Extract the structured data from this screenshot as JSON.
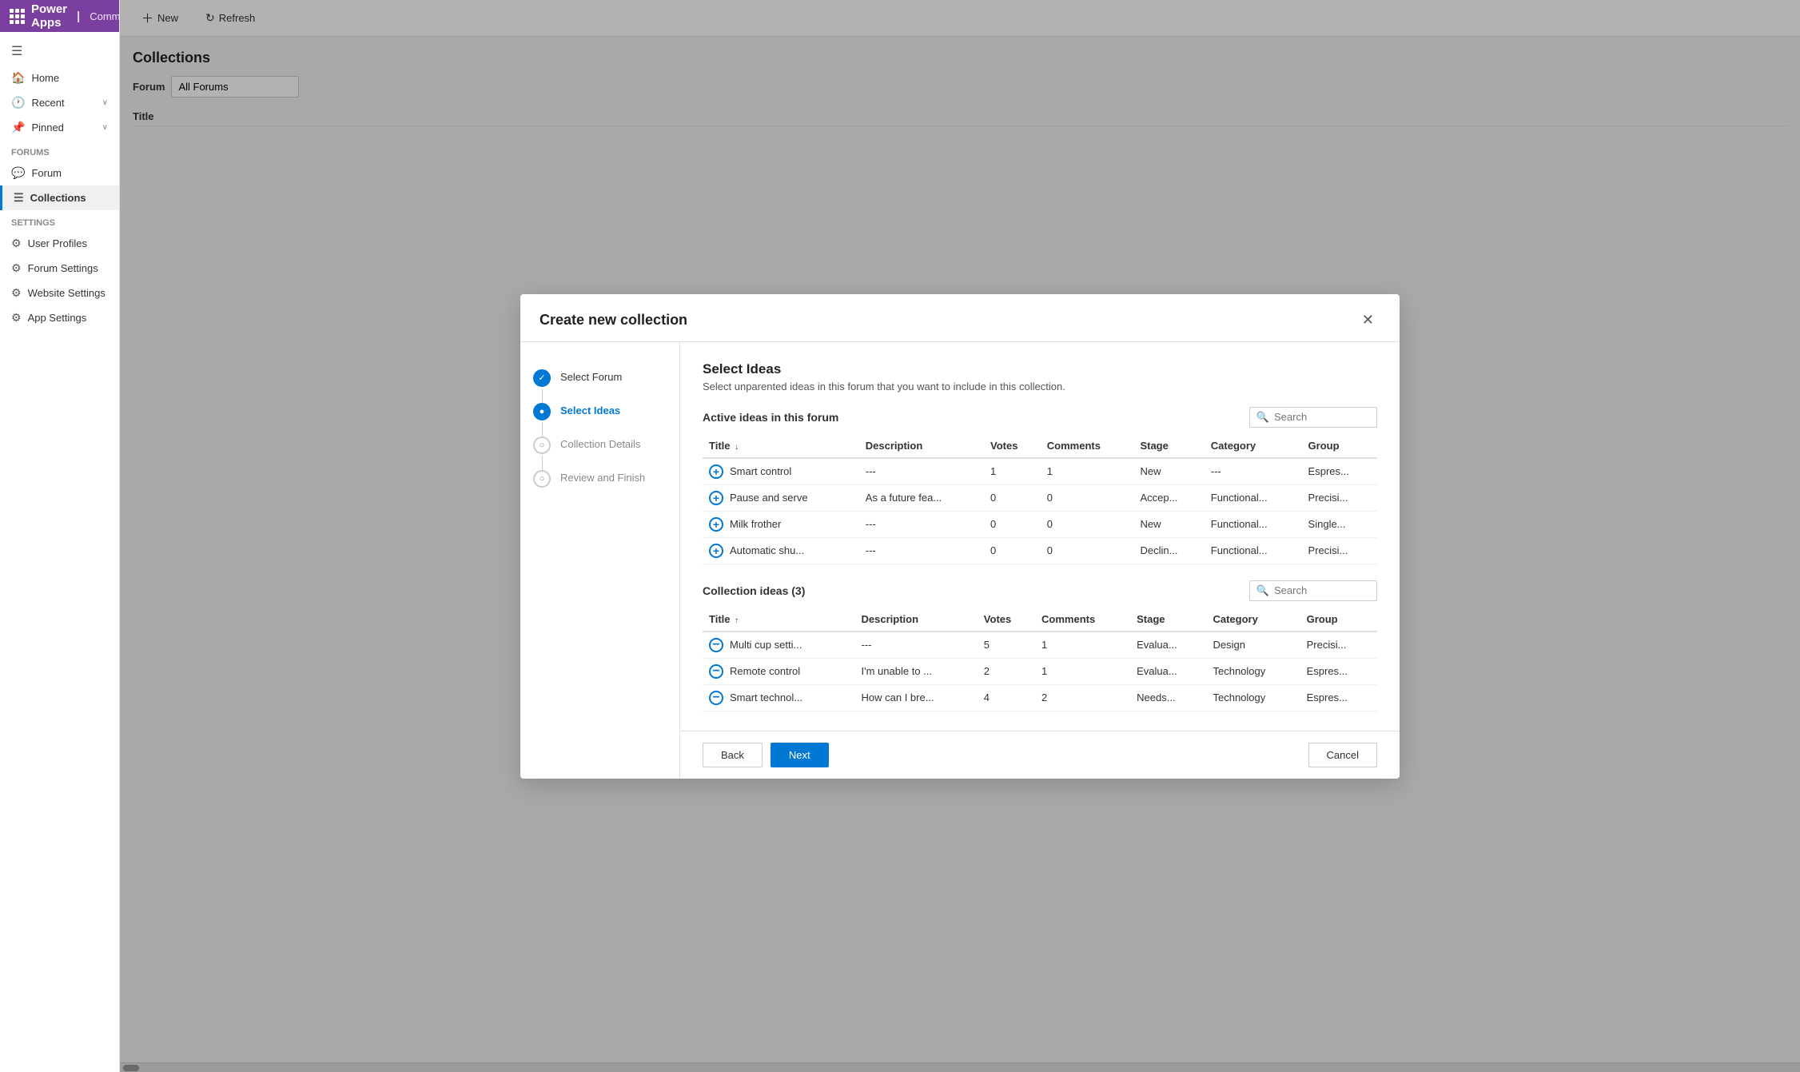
{
  "app": {
    "name": "Power Apps",
    "community": "Community"
  },
  "sidebar": {
    "sections": [
      {
        "items": [
          {
            "id": "home",
            "label": "Home",
            "icon": "🏠"
          },
          {
            "id": "recent",
            "label": "Recent",
            "icon": "🕐",
            "hasChevron": true
          },
          {
            "id": "pinned",
            "label": "Pinned",
            "icon": "📌",
            "hasChevron": true
          }
        ]
      },
      {
        "label": "Forums",
        "items": [
          {
            "id": "forum",
            "label": "Forum",
            "icon": "💬"
          },
          {
            "id": "collections",
            "label": "Collections",
            "icon": "📋",
            "active": true
          }
        ]
      },
      {
        "label": "Settings",
        "items": [
          {
            "id": "user-profiles",
            "label": "User Profiles",
            "icon": "👤"
          },
          {
            "id": "forum-settings",
            "label": "Forum Settings",
            "icon": "⚙"
          },
          {
            "id": "website-settings",
            "label": "Website Settings",
            "icon": "⚙"
          },
          {
            "id": "app-settings",
            "label": "App Settings",
            "icon": "⚙"
          }
        ]
      }
    ]
  },
  "toolbar": {
    "new_label": "New",
    "refresh_label": "Refresh"
  },
  "page": {
    "title": "Collections",
    "filter_placeholder": "All Forums",
    "table": {
      "columns": [
        "Title"
      ]
    }
  },
  "modal": {
    "title": "Create new collection",
    "steps": [
      {
        "id": "select-forum",
        "label": "Select Forum",
        "state": "completed"
      },
      {
        "id": "select-ideas",
        "label": "Select Ideas",
        "state": "active"
      },
      {
        "id": "collection-details",
        "label": "Collection Details",
        "state": "inactive"
      },
      {
        "id": "review-finish",
        "label": "Review and Finish",
        "state": "inactive"
      }
    ],
    "content": {
      "title": "Select Ideas",
      "subtitle": "Select unparented ideas in this forum that you want to include in this collection.",
      "active_section": {
        "label": "Active ideas in this forum",
        "search_placeholder": "Search",
        "columns": [
          "Title",
          "Description",
          "Votes",
          "Comments",
          "Stage",
          "Category",
          "Group"
        ],
        "title_sort": "↓",
        "rows": [
          {
            "title": "Smart control",
            "description": "---",
            "votes": "1",
            "comments": "1",
            "stage": "New",
            "category": "---",
            "group": "Espres..."
          },
          {
            "title": "Pause and serve",
            "description": "As a future fea...",
            "votes": "0",
            "comments": "0",
            "stage": "Accep...",
            "category": "Functional...",
            "group": "Precisi..."
          },
          {
            "title": "Milk frother",
            "description": "---",
            "votes": "0",
            "comments": "0",
            "stage": "New",
            "category": "Functional...",
            "group": "Single..."
          },
          {
            "title": "Automatic shu...",
            "description": "---",
            "votes": "0",
            "comments": "0",
            "stage": "Declin...",
            "category": "Functional...",
            "group": "Precisi..."
          }
        ]
      },
      "collection_section": {
        "label": "Collection ideas (3)",
        "search_placeholder": "Search",
        "columns": [
          "Title",
          "Description",
          "Votes",
          "Comments",
          "Stage",
          "Category",
          "Group"
        ],
        "title_sort": "↑",
        "rows": [
          {
            "title": "Multi cup setti...",
            "description": "---",
            "votes": "5",
            "comments": "1",
            "stage": "Evalua...",
            "category": "Design",
            "group": "Precisi..."
          },
          {
            "title": "Remote control",
            "description": "I'm unable to ...",
            "votes": "2",
            "comments": "1",
            "stage": "Evalua...",
            "category": "Technology",
            "group": "Espres..."
          },
          {
            "title": "Smart technol...",
            "description": "How can I bre...",
            "votes": "4",
            "comments": "2",
            "stage": "Needs...",
            "category": "Technology",
            "group": "Espres..."
          }
        ]
      }
    },
    "footer": {
      "back_label": "Back",
      "next_label": "Next",
      "cancel_label": "Cancel"
    }
  }
}
